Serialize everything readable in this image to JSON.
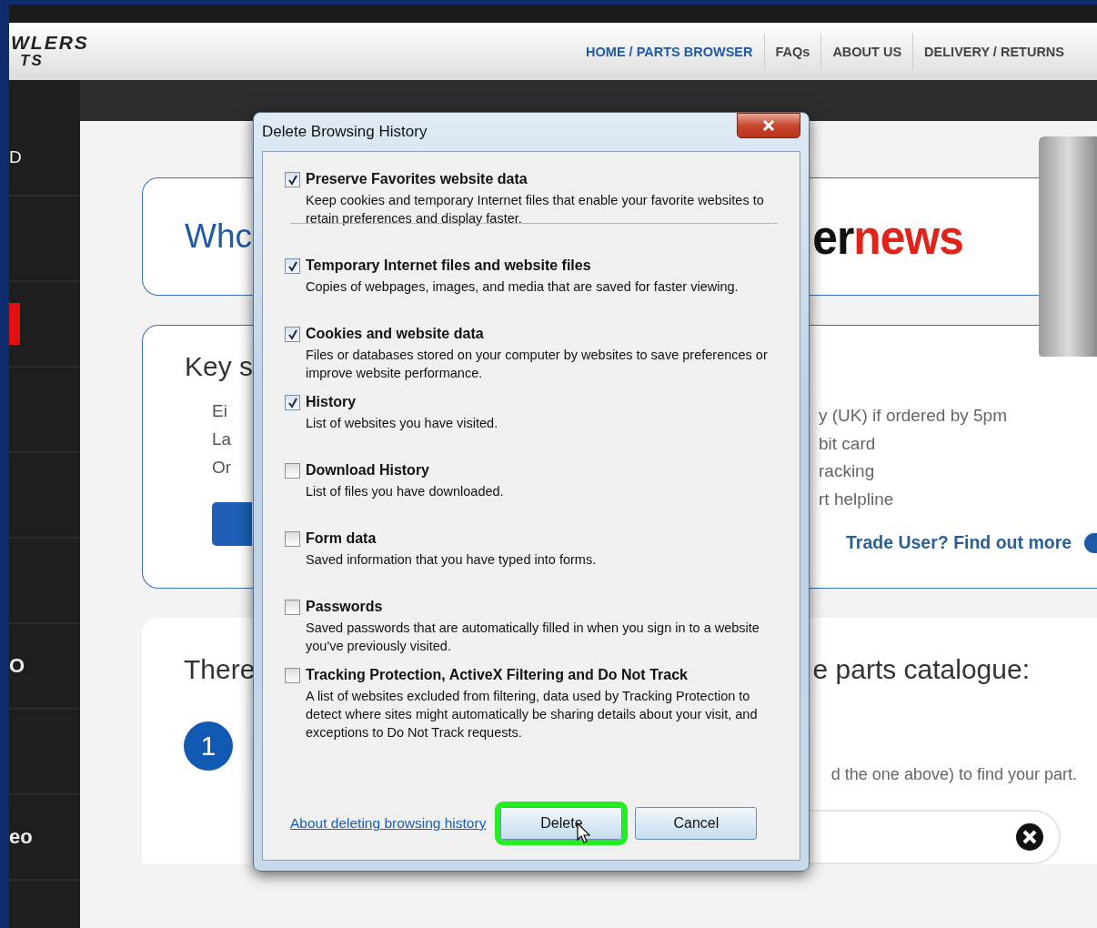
{
  "site_header": {
    "logo_lines": [
      "WLERS",
      "TS"
    ],
    "nav": [
      {
        "label": "HOME / PARTS BROWSER",
        "selected": true
      },
      {
        "label": "FAQs",
        "selected": false
      },
      {
        "label": "ABOUT US",
        "selected": false
      },
      {
        "label": "DELIVERY / RETURNS",
        "selected": false
      }
    ]
  },
  "sidebar_items": [
    {
      "kind": "text",
      "text": "D"
    },
    {
      "kind": "blank"
    },
    {
      "kind": "red-mark"
    },
    {
      "kind": "blank"
    },
    {
      "kind": "blank"
    },
    {
      "kind": "blank"
    },
    {
      "kind": "text",
      "text": "O"
    },
    {
      "kind": "blank"
    },
    {
      "kind": "text",
      "text": "eo"
    },
    {
      "kind": "blank"
    }
  ],
  "page": {
    "intro_card": {
      "heading": "Whc",
      "brand_dark": "er",
      "brand_red": "news"
    },
    "features_card": {
      "heading": "Key s",
      "bullets": [
        "Ei",
        "La",
        "Or"
      ],
      "right_lines": [
        "y (UK) if ordered by 5pm",
        "bit card",
        "racking",
        "rt helpline"
      ],
      "trade_link": "Trade User? Find out more"
    },
    "catalogue_card": {
      "heading_left": "There",
      "heading_right": "e parts catalogue:",
      "step": "1",
      "step_text": "d the one above) to find your part."
    }
  },
  "dialog": {
    "title": "Delete Browsing History",
    "options": [
      {
        "label": "Preserve Favorites website data",
        "description": "Keep cookies and temporary Internet files that enable your favorite websites to retain preferences and display faster.",
        "checked": true
      },
      {
        "label": "Temporary Internet files and website files",
        "description": "Copies of webpages, images, and media that are saved for faster viewing.",
        "checked": true
      },
      {
        "label": "Cookies and website data",
        "description": "Files or databases stored on your computer by websites to save preferences or improve website performance.",
        "checked": true
      },
      {
        "label": "History",
        "description": "List of websites you have visited.",
        "checked": true
      },
      {
        "label": "Download History",
        "description": "List of files you have downloaded.",
        "checked": false
      },
      {
        "label": "Form data",
        "description": "Saved information that you have typed into forms.",
        "checked": false
      },
      {
        "label": "Passwords",
        "description": "Saved passwords that are automatically filled in when you sign in to a website you've previously visited.",
        "checked": false
      },
      {
        "label": "Tracking Protection, ActiveX Filtering and Do Not Track",
        "description": "A list of websites excluded from filtering, data used by Tracking Protection to detect where sites might automatically be sharing details about your visit, and exceptions to Do Not Track requests.",
        "checked": false
      }
    ],
    "help_link": "About deleting browsing history",
    "buttons": [
      {
        "label": "Delete",
        "highlighted": true
      },
      {
        "label": "Cancel",
        "highlighted": false
      }
    ]
  }
}
